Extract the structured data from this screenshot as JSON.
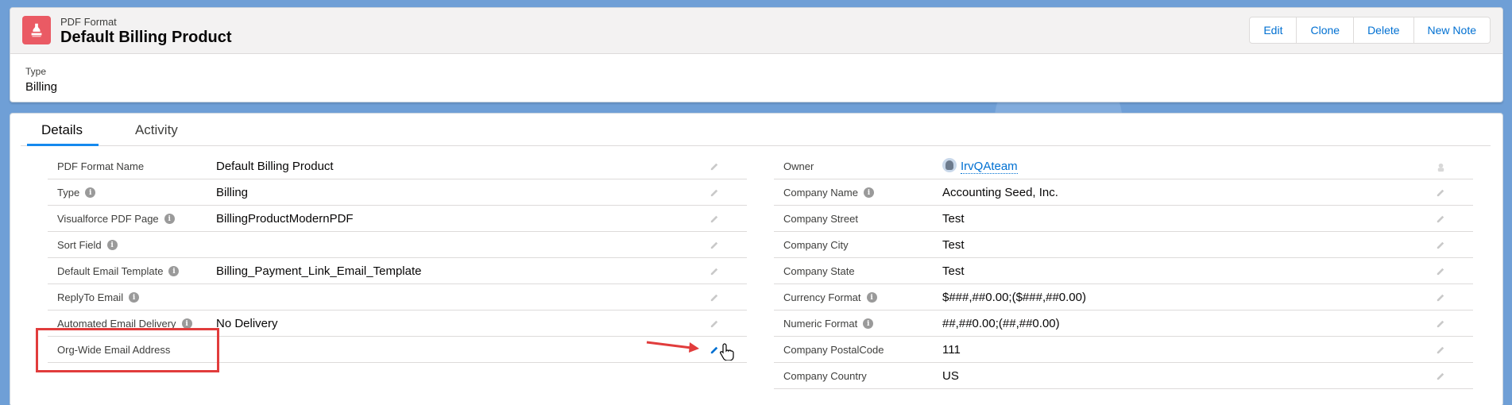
{
  "header": {
    "object_name": "PDF Format",
    "record_title": "Default Billing Product",
    "actions": [
      "Edit",
      "Clone",
      "Delete",
      "New Note"
    ],
    "highlight": {
      "label": "Type",
      "value": "Billing"
    },
    "icon_color": "#ea5a64",
    "record_icon": "stamp-icon"
  },
  "tabs": [
    "Details",
    "Activity"
  ],
  "left_fields": [
    {
      "label": "PDF Format Name",
      "value": "Default Billing Product",
      "info": false
    },
    {
      "label": "Type",
      "value": "Billing",
      "info": true
    },
    {
      "label": "Visualforce PDF Page",
      "value": "BillingProductModernPDF",
      "info": true
    },
    {
      "label": "Sort Field",
      "value": "",
      "info": true
    },
    {
      "label": "Default Email Template",
      "value": "Billing_Payment_Link_Email_Template",
      "info": true
    },
    {
      "label": "ReplyTo Email",
      "value": "",
      "info": true
    },
    {
      "label": "Automated Email Delivery",
      "value": "No Delivery",
      "info": true
    },
    {
      "label": "Org-Wide Email Address",
      "value": "",
      "info": false
    }
  ],
  "right_fields": [
    {
      "label": "Owner",
      "value": "IrvQAteam",
      "info": false
    },
    {
      "label": "Company Name",
      "value": "Accounting Seed, Inc.",
      "info": true
    },
    {
      "label": "Company Street",
      "value": "Test",
      "info": false
    },
    {
      "label": "Company City",
      "value": "Test",
      "info": false
    },
    {
      "label": "Company State",
      "value": "Test",
      "info": false
    },
    {
      "label": "Currency Format",
      "value": "$###,##0.00;($###,##0.00)",
      "info": true
    },
    {
      "label": "Numeric Format",
      "value": "##,##0.00;(##,##0.00)",
      "info": true
    },
    {
      "label": "Company PostalCode",
      "value": "111",
      "info": false
    },
    {
      "label": "Company Country",
      "value": "US",
      "info": false
    }
  ],
  "colors": {
    "link": "#0070d2",
    "annotation": "#e13c3c",
    "tab_active": "#1589ee"
  }
}
